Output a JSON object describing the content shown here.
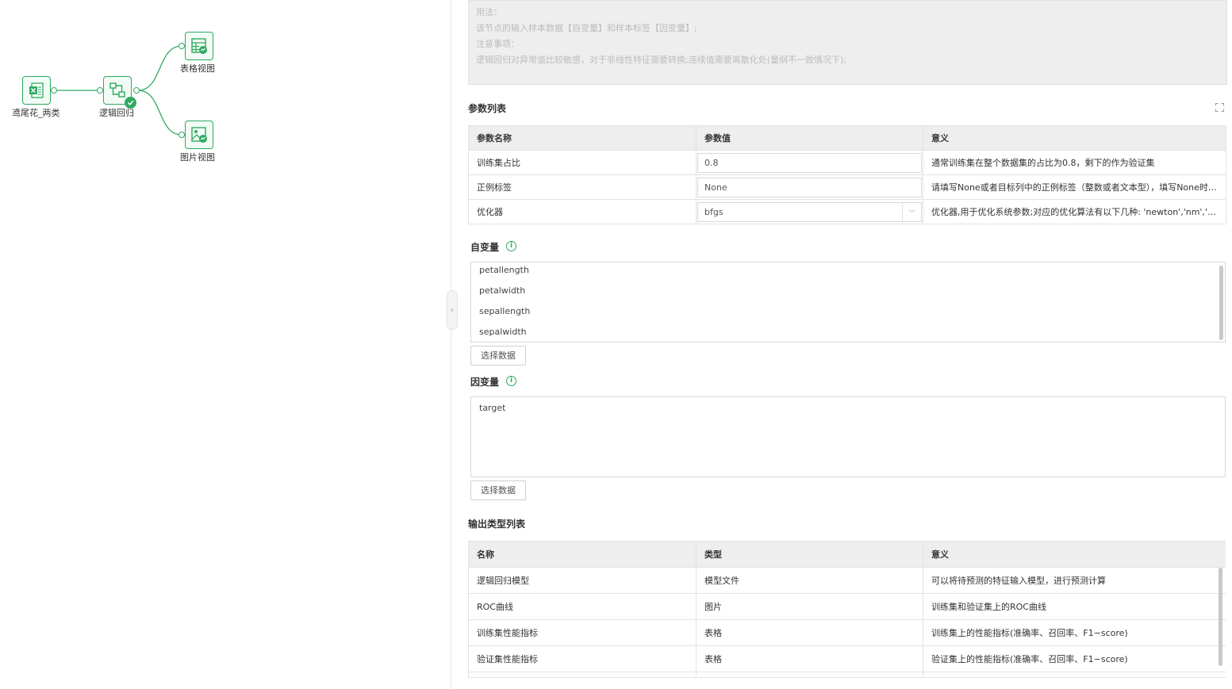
{
  "canvas": {
    "nodes": {
      "source": {
        "label": "鸢尾花_两类",
        "icon": "excel-file-icon"
      },
      "model": {
        "label": "逻辑回归",
        "icon": "logistic-regression-icon",
        "status": "success"
      },
      "table_view": {
        "label": "表格视图",
        "icon": "table-view-icon"
      },
      "image_view": {
        "label": "图片视图",
        "icon": "image-view-icon"
      }
    },
    "accent_color": "#2eaa5f"
  },
  "description": {
    "lines": [
      "用法：",
      "该节点的输入样本数据【自变量】和样本标签【因变量】;",
      "注意事项：",
      "逻辑回归对异常值比较敏感，对于非线性特征需要转换;连续值需要离散化处(量纲不一致情况下);"
    ]
  },
  "params": {
    "title": "参数列表",
    "headers": [
      "参数名称",
      "参数值",
      "意义"
    ],
    "rows": [
      {
        "name": "训练集占比",
        "value": "0.8",
        "meaning": "通常训练集在整个数据集的占比为0.8，剩下的作为验证集"
      },
      {
        "name": "正例标签",
        "value": "None",
        "meaning": "请填写None或者目标列中的正例标签（整数或者文本型），填写None时，默认选择的是目标列中的排序最大的类别作为正例标签"
      },
      {
        "name": "优化器",
        "value": "bfgs",
        "meaning": "优化器,用于优化系统参数;对应的优化算法有以下几种: 'newton','nm','bfgs','lbfgs','powell','cg','ncg','basinhopping','minimize'"
      }
    ]
  },
  "independent": {
    "title": "自变量",
    "items": [
      "petallength",
      "petalwidth",
      "sepallength",
      "sepalwidth"
    ],
    "button": "选择数据"
  },
  "dependent": {
    "title": "因变量",
    "items": [
      "target"
    ],
    "button": "选择数据"
  },
  "outputs": {
    "title": "输出类型列表",
    "headers": [
      "名称",
      "类型",
      "意义"
    ],
    "rows": [
      {
        "name": "逻辑回归模型",
        "type": "模型文件",
        "meaning": "可以将待预测的特征输入模型，进行预测计算"
      },
      {
        "name": "ROC曲线",
        "type": "图片",
        "meaning": "训练集和验证集上的ROC曲线"
      },
      {
        "name": "训练集性能指标",
        "type": "表格",
        "meaning": "训练集上的性能指标(准确率、召回率、F1−score)"
      },
      {
        "name": "验证集性能指标",
        "type": "表格",
        "meaning": "验证集上的性能指标(准确率、召回率、F1−score)"
      }
    ]
  }
}
